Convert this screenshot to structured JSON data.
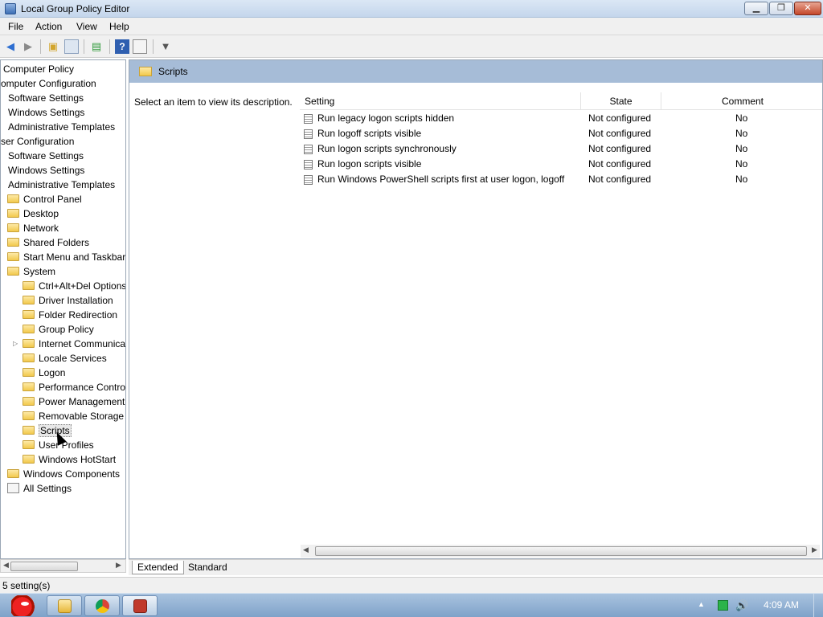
{
  "window": {
    "title": "Local Group Policy Editor"
  },
  "menu": [
    "File",
    "Action",
    "View",
    "Help"
  ],
  "tree": [
    {
      "label": "Computer Policy"
    },
    {
      "label": "omputer Configuration"
    },
    {
      "label": "Software Settings"
    },
    {
      "label": "Windows Settings"
    },
    {
      "label": "Administrative Templates"
    },
    {
      "label": "ser Configuration"
    },
    {
      "label": "Software Settings"
    },
    {
      "label": "Windows Settings"
    },
    {
      "label": "Administrative Templates"
    },
    {
      "label": "Control Panel"
    },
    {
      "label": "Desktop"
    },
    {
      "label": "Network"
    },
    {
      "label": "Shared Folders"
    },
    {
      "label": "Start Menu and Taskbar"
    },
    {
      "label": "System"
    },
    {
      "label": "Ctrl+Alt+Del Options"
    },
    {
      "label": "Driver Installation"
    },
    {
      "label": "Folder Redirection"
    },
    {
      "label": "Group Policy"
    },
    {
      "label": "Internet Communication Management"
    },
    {
      "label": "Locale Services"
    },
    {
      "label": "Logon"
    },
    {
      "label": "Performance Control Panel"
    },
    {
      "label": "Power Management"
    },
    {
      "label": "Removable Storage Access"
    },
    {
      "label": "Scripts"
    },
    {
      "label": "User Profiles"
    },
    {
      "label": "Windows HotStart"
    },
    {
      "label": "Windows Components"
    },
    {
      "label": "All Settings"
    }
  ],
  "right": {
    "title": "Scripts",
    "description": "Select an item to view its description.",
    "columns": {
      "setting": "Setting",
      "state": "State",
      "comment": "Comment"
    },
    "rows": [
      {
        "setting": "Run legacy logon scripts hidden",
        "state": "Not configured",
        "comment": "No"
      },
      {
        "setting": "Run logoff scripts visible",
        "state": "Not configured",
        "comment": "No"
      },
      {
        "setting": "Run logon scripts synchronously",
        "state": "Not configured",
        "comment": "No"
      },
      {
        "setting": "Run logon scripts visible",
        "state": "Not configured",
        "comment": "No"
      },
      {
        "setting": "Run Windows PowerShell scripts first at user logon, logoff",
        "state": "Not configured",
        "comment": "No"
      }
    ]
  },
  "tabs": {
    "extended": "Extended",
    "standard": "Standard"
  },
  "status": {
    "text": "5 setting(s)"
  },
  "taskbar": {
    "clock": "4:09 AM"
  },
  "colors": {
    "header": "#a6bcd7",
    "taskbar": "#8fb0d4",
    "close_button": "#c4472a"
  }
}
